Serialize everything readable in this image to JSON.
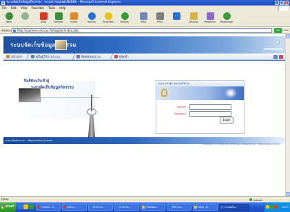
{
  "window": {
    "title": "ระบบจัดเก็บข้อมูลกิจกรรม : ระบบสารสนเทศเพื่อนิสิต - Microsoft Internet Explorer",
    "buttons": [
      "_",
      "□",
      "x"
    ]
  },
  "menu": [
    "File",
    "Edit",
    "View",
    "Favorites",
    "Tools",
    "Help"
  ],
  "toolbar": {
    "buttons": [
      {
        "label": "Back",
        "icon": "back-arrow-icon",
        "color": "#3c8d3c"
      },
      {
        "label": "",
        "icon": "forward-arrow-icon",
        "color": "#8fb58f"
      },
      {
        "label": "Stop",
        "icon": "stop-icon",
        "color": "#d33b2c"
      },
      {
        "label": "Refresh",
        "icon": "refresh-icon",
        "color": "#3a8e3a"
      },
      {
        "label": "Home",
        "icon": "home-icon",
        "color": "#d98a2b"
      },
      {
        "label": "Search",
        "icon": "search-icon",
        "color": "#2b6fd0"
      },
      {
        "label": "Favorites",
        "icon": "favorites-star-icon",
        "color": "#e7c21e"
      },
      {
        "label": "History",
        "icon": "history-icon",
        "color": "#3a9a3a"
      },
      {
        "label": "Mail",
        "icon": "mail-icon",
        "color": "#6f88b8"
      },
      {
        "label": "Print",
        "icon": "print-icon",
        "color": "#7f7f7f"
      },
      {
        "label": "",
        "icon": "edit-icon",
        "color": "#2b6fd0"
      },
      {
        "label": "Discuss",
        "icon": "discuss-icon",
        "color": "#d6b34a"
      },
      {
        "label": "Research",
        "icon": "research-icon",
        "color": "#8a6bc0"
      },
      {
        "label": "Messenger",
        "icon": "messenger-icon",
        "color": "#3a9a3a"
      }
    ]
  },
  "address": {
    "label": "Address",
    "url": "http://supreme.cmu.ac.th/register/index.php",
    "go": "Go",
    "links": "Links"
  },
  "site": {
    "title": "ระบบจัดเก็บข้อมูลกิจกรรม",
    "nav": [
      {
        "label": "หน้าแรก",
        "color": "#d98a2b"
      },
      {
        "label": "คู่มือผู้ใช้งานระบบ",
        "color": "#3f86d6"
      },
      {
        "label": "ติดต่อสอบถาม",
        "color": "#7a6bc0"
      },
      {
        "label": "ผู้จัดทำ",
        "color": "#c05050"
      }
    ],
    "welcome": "ยินดีต้อนรับเข้าสู่",
    "system_title": "ระบบจัดเก็บข้อมูลกิจกรรม",
    "strip_text": "ลงทะเบียนกิจกรรม :: Registration System",
    "copyright": "Copyright © Chiang Mai University Designed by IT Registration Center",
    "login": {
      "header": "กรุณาเข้าสู่ระบบก่อนใช้งาน",
      "user_label": "User ID",
      "pass_label": "Password",
      "user_value": "",
      "pass_value": "",
      "button": "Login"
    }
  },
  "status": {
    "text": "Done",
    "zone": "Internet"
  },
  "taskbar": {
    "start": "start",
    "tasks": [
      {
        "label": "2 Yahoo! - S...",
        "color": "#c64a2b"
      },
      {
        "label": "CMU e-...",
        "color": "#c64a2b"
      },
      {
        "label": "PLIS9 Se...",
        "color": "#2e7bd6"
      },
      {
        "label": "PLIS9 Se...",
        "color": "#2e7bd6"
      },
      {
        "label": "2 Window...",
        "color": "#e2c14a"
      },
      {
        "label": "TMU Cus...",
        "color": "#2e7bd6"
      },
      {
        "label": "Inbox - M...",
        "color": "#e2c14a"
      },
      {
        "label": "ระบบจัดเก็บ...",
        "color": "#2e7bd6"
      }
    ],
    "clock": "14:25"
  }
}
